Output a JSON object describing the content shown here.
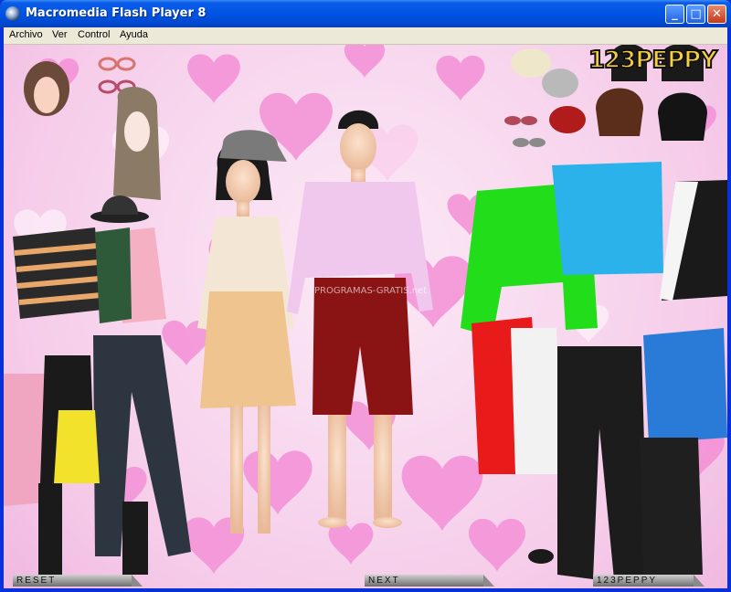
{
  "window": {
    "title": "Macromedia Flash Player 8",
    "controls": {
      "minimize": "_",
      "maximize": "□",
      "close": "✕"
    }
  },
  "menu": {
    "items": [
      "Archivo",
      "Ver",
      "Control",
      "Ayuda"
    ]
  },
  "game": {
    "logo": "123PEPPY",
    "watermark": "PROGRAMAS-GRATIS.net",
    "buttons": {
      "reset": "RESET",
      "next": "NEXT",
      "brand": "123PEPPY"
    }
  },
  "colors": {
    "background": "#f6cdea",
    "hearts": "#f48fd6",
    "logo_fill": "#f7ce3e"
  }
}
